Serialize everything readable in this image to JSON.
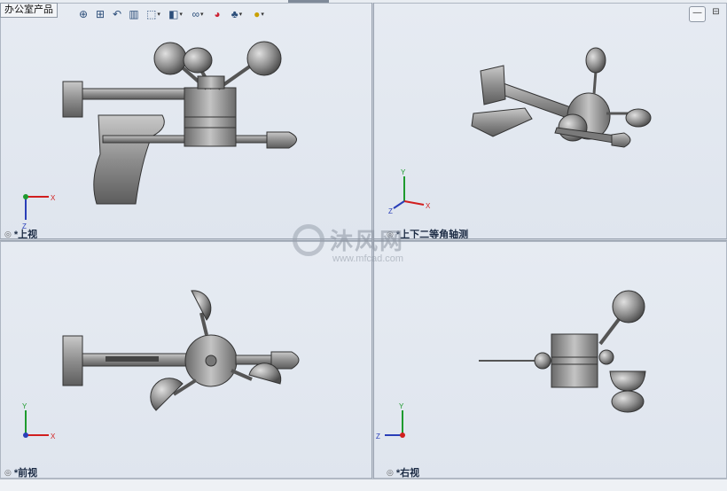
{
  "window": {
    "tree_tab": "办公室产品",
    "colors": {
      "background": "#e2e8ef",
      "part": "#9a9a9a",
      "axis_x": "#d11f1f",
      "axis_y": "#1e9b2e",
      "axis_z": "#2a3fb8"
    }
  },
  "toolbar": {
    "icons": [
      "zoom-to-fit-icon",
      "zoom-area-icon",
      "previous-view-icon",
      "section-view-icon",
      "view-orientation-icon",
      "display-style-icon",
      "hide-show-icon",
      "edit-appearance-icon",
      "apply-scene-icon",
      "view-settings-icon"
    ]
  },
  "window_buttons": {
    "minimize": "—",
    "restore": "⊟"
  },
  "viewports": {
    "top": {
      "label": "*上视"
    },
    "iso": {
      "label": "*上下二等角轴测"
    },
    "front": {
      "label": "*前视"
    },
    "right": {
      "label": "*右视"
    }
  },
  "axes": {
    "x": "X",
    "y": "Y",
    "z": "Z"
  },
  "watermark": {
    "main": "沐风网",
    "sub": "www.mfcad.com"
  }
}
